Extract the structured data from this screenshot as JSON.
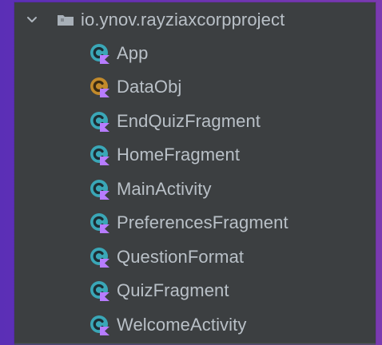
{
  "tree": {
    "package_name": "io.ynov.rayziaxcorpproject",
    "items": [
      {
        "label": "App",
        "icon": "class-kotlin-icon",
        "tone": "teal"
      },
      {
        "label": "DataObj",
        "icon": "data-object-kotlin-icon",
        "tone": "orange"
      },
      {
        "label": "EndQuizFragment",
        "icon": "class-kotlin-icon",
        "tone": "teal"
      },
      {
        "label": "HomeFragment",
        "icon": "class-kotlin-icon",
        "tone": "teal"
      },
      {
        "label": "MainActivity",
        "icon": "class-kotlin-icon",
        "tone": "teal"
      },
      {
        "label": "PreferencesFragment",
        "icon": "class-kotlin-icon",
        "tone": "teal"
      },
      {
        "label": "QuestionFormat",
        "icon": "class-kotlin-icon",
        "tone": "teal"
      },
      {
        "label": "QuizFragment",
        "icon": "class-kotlin-icon",
        "tone": "teal"
      },
      {
        "label": "WelcomeActivity",
        "icon": "class-kotlin-icon",
        "tone": "teal"
      }
    ]
  },
  "colors": {
    "panel_background": "#3c3f41",
    "text": "#b9c0c7",
    "teal_icon": "#3aa7b7",
    "orange_icon": "#c28a2b",
    "kotlin_badge": "#b77cff",
    "folder_icon": "#a8b0b8"
  }
}
